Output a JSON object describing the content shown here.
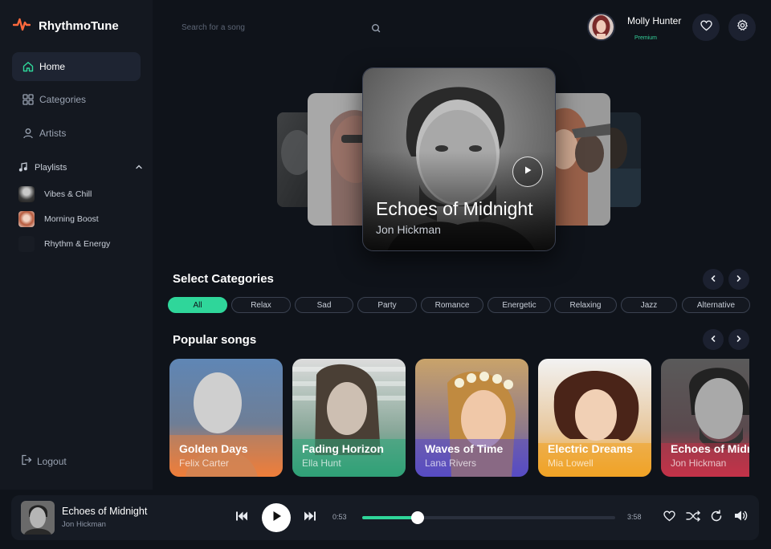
{
  "app": {
    "name": "RhythmoTune"
  },
  "colors": {
    "accent": "#2fd69a",
    "logo": "#ff6a3d",
    "bg": "#0f131a",
    "sidebar": "#141820"
  },
  "sidebar": {
    "nav": [
      {
        "label": "Home",
        "icon": "home-icon",
        "active": true
      },
      {
        "label": "Categories",
        "icon": "grid-icon",
        "active": false
      },
      {
        "label": "Artists",
        "icon": "user-icon",
        "active": false
      }
    ],
    "playlists_label": "Playlists",
    "playlists": [
      {
        "label": "Vibes & Chill"
      },
      {
        "label": "Morning Boost"
      },
      {
        "label": "Rhythm & Energy"
      }
    ],
    "logout_label": "Logout"
  },
  "header": {
    "search_placeholder": "Search for a song",
    "user": {
      "name": "Molly Hunter",
      "plan": "Premium"
    }
  },
  "hero": {
    "title": "Echoes of Midnight",
    "artist": "Jon Hickman"
  },
  "categories": {
    "title": "Select Categories",
    "items": [
      "All",
      "Relax",
      "Sad",
      "Party",
      "Romance",
      "Energetic",
      "Relaxing",
      "Jazz",
      "Alternative"
    ],
    "selected": "All"
  },
  "popular": {
    "title": "Popular songs",
    "songs": [
      {
        "title": "Golden Days",
        "artist": "Felix Carter"
      },
      {
        "title": "Fading Horizon",
        "artist": "Ella Hunt"
      },
      {
        "title": "Waves of Time",
        "artist": "Lana Rivers"
      },
      {
        "title": "Electric Dreams",
        "artist": "Mia Lowell"
      },
      {
        "title": "Echoes of Midnight",
        "artist": "Jon Hickman"
      }
    ]
  },
  "player": {
    "title": "Echoes of Midnight",
    "artist": "Jon Hickman",
    "elapsed": "0:53",
    "duration": "3:58",
    "progress": 0.22
  }
}
